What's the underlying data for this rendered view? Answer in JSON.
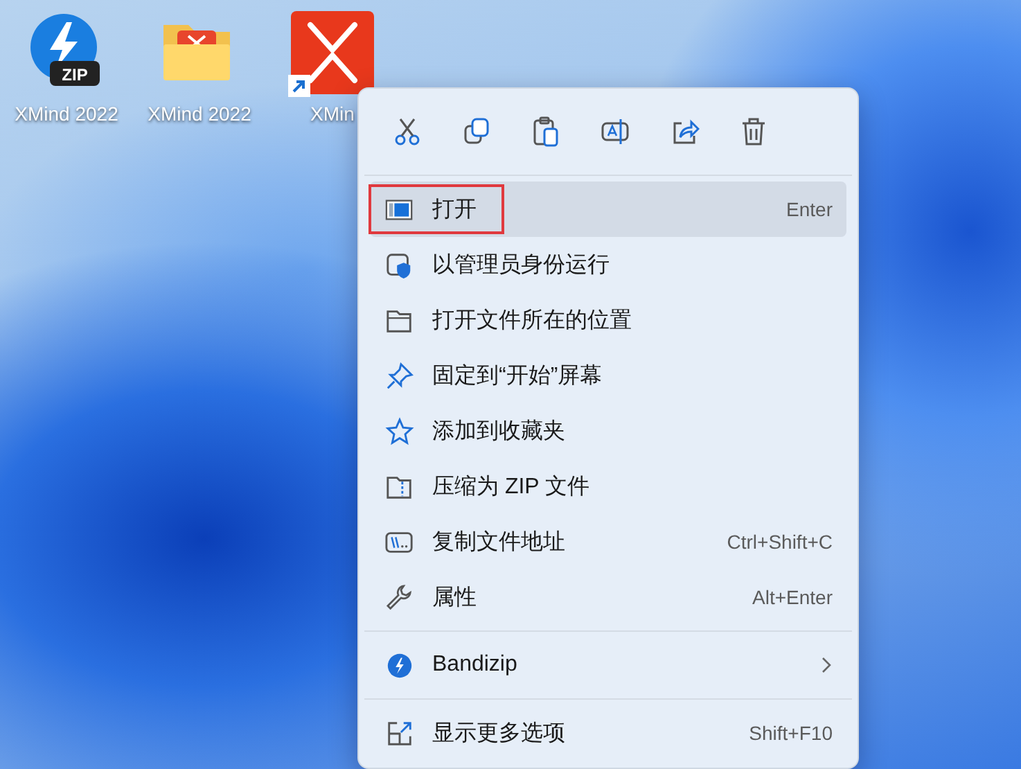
{
  "desktop_icons": [
    {
      "label": "XMind 2022",
      "badge": "ZIP",
      "shortcut": false
    },
    {
      "label": "XMind 2022",
      "shortcut": false
    },
    {
      "label": "XMin",
      "shortcut": true
    }
  ],
  "context_menu": {
    "groups": [
      [
        {
          "label": "打开",
          "shortcut": "Enter",
          "selected": true,
          "annotated": true,
          "submenu": false
        },
        {
          "label": "以管理员身份运行",
          "selected": false,
          "annotated": false,
          "submenu": false
        },
        {
          "label": "打开文件所在的位置",
          "selected": false,
          "annotated": false,
          "submenu": false
        },
        {
          "label": "固定到“开始”屏幕",
          "selected": false,
          "annotated": false,
          "submenu": false
        },
        {
          "label": "添加到收藏夹",
          "selected": false,
          "annotated": false,
          "submenu": false
        },
        {
          "label": "压缩为 ZIP 文件",
          "selected": false,
          "annotated": false,
          "submenu": false
        },
        {
          "label": "复制文件地址",
          "shortcut": "Ctrl+Shift+C",
          "selected": false,
          "annotated": false,
          "submenu": false
        },
        {
          "label": "属性",
          "shortcut": "Alt+Enter",
          "selected": false,
          "annotated": false,
          "submenu": false
        }
      ],
      [
        {
          "label": "Bandizip",
          "selected": false,
          "annotated": false,
          "submenu": true
        }
      ],
      [
        {
          "label": "显示更多选项",
          "shortcut": "Shift+F10",
          "selected": false,
          "annotated": false,
          "submenu": false
        }
      ]
    ]
  }
}
